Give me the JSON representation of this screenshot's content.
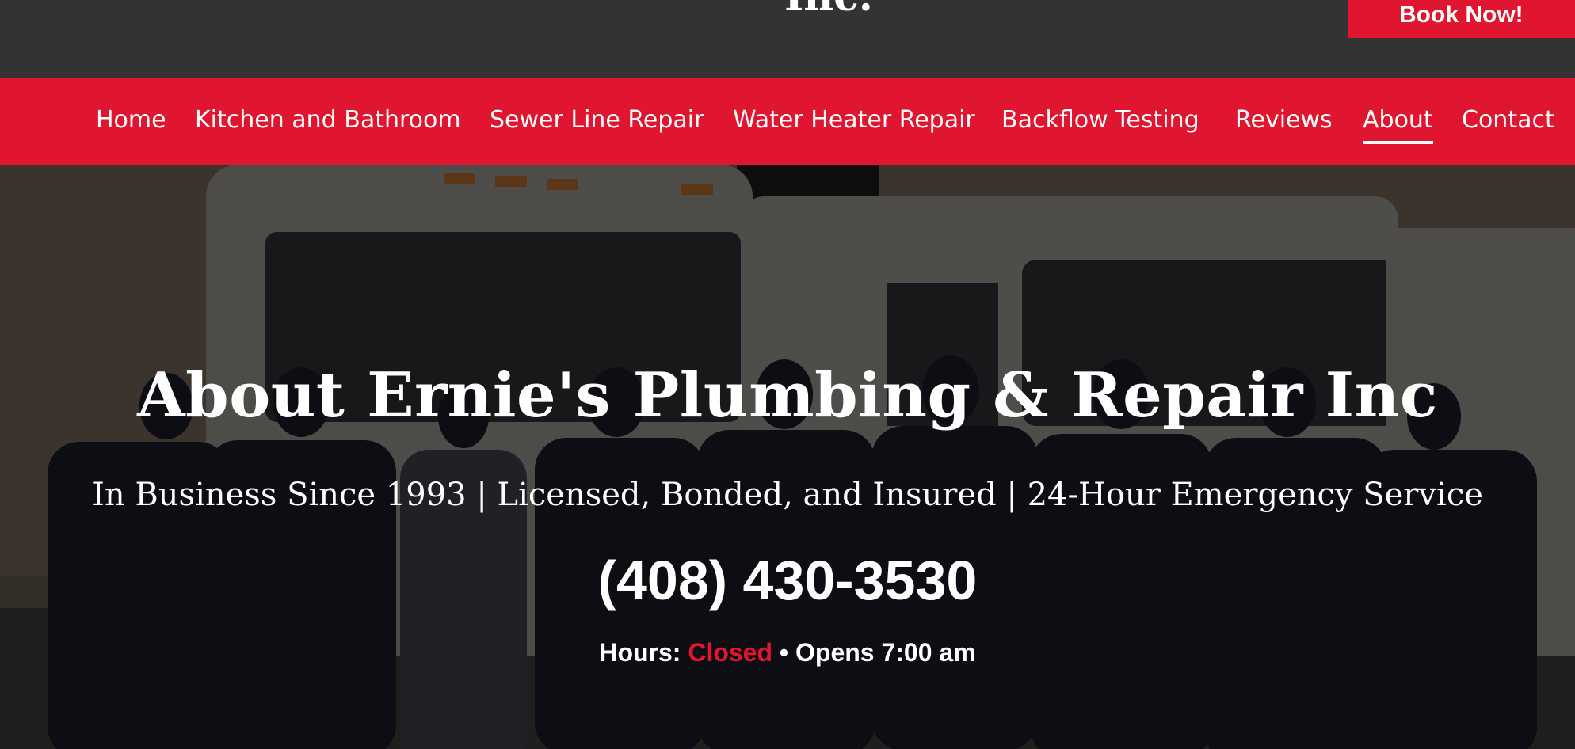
{
  "header": {
    "logo_text": "Inc.",
    "book_button": "Book Now!"
  },
  "nav": {
    "items": [
      {
        "label": "Home",
        "active": false
      },
      {
        "label": "Kitchen and Bathroom",
        "active": false
      },
      {
        "label": "Sewer Line Repair",
        "active": false
      },
      {
        "label": "Water Heater Repair",
        "active": false
      },
      {
        "label": "Backflow Testing",
        "active": false
      },
      {
        "label": "Reviews",
        "active": false
      },
      {
        "label": "About",
        "active": true
      },
      {
        "label": "Contact",
        "active": false
      }
    ]
  },
  "hero": {
    "title": "About Ernie's Plumbing & Repair Inc",
    "subtitle": "In Business Since 1993 | Licensed, Bonded, and Insured | 24-Hour Emergency Service",
    "phone": "(408) 430-3530",
    "hours_label": "Hours:",
    "hours_status": "Closed",
    "hours_separator": "•",
    "hours_next": "Opens 7:00 am",
    "background_image": "team-photo-with-trucks"
  },
  "colors": {
    "accent_red": "#e0152f",
    "topbar_dark": "#333333",
    "text_white": "#ffffff"
  }
}
